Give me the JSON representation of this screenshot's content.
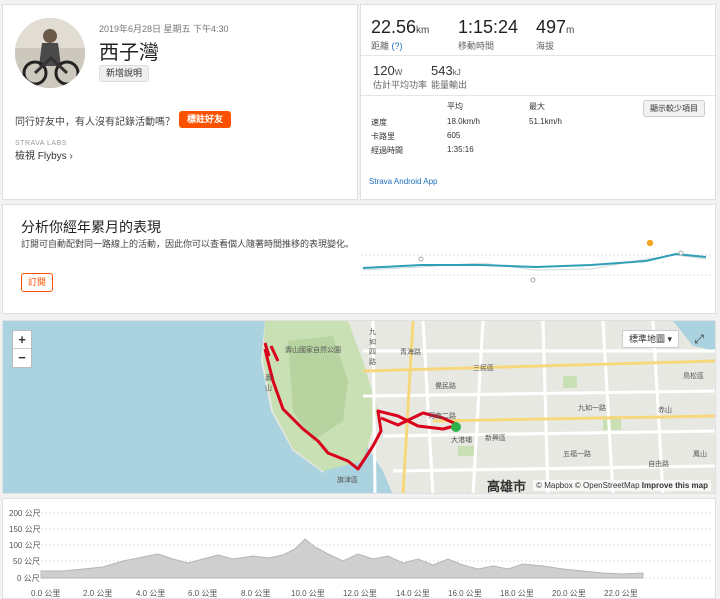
{
  "activity": {
    "date": "2019年6月28日 星期五 下午4:30",
    "title": "西子灣",
    "add_description": "新增說明",
    "friend_question": "同行好友中，有人沒有記錄活動嗎？",
    "tag_friends": "標註好友",
    "labs": "STRAVA LABS",
    "flybys": "檢視 Flybys",
    "flybys_icon": "chevron-right"
  },
  "stats": {
    "distance": {
      "value": "22.56",
      "unit": "km",
      "label": "距離",
      "help": "(?)"
    },
    "moving_time": {
      "value": "1:15:24",
      "label": "移動時間"
    },
    "elevation": {
      "value": "497",
      "unit": "m",
      "label": "海拔"
    },
    "power": {
      "value": "120",
      "unit": "W",
      "label": "估計平均功率"
    },
    "energy": {
      "value": "543",
      "unit": "kJ",
      "label": "能量輸出"
    },
    "table": {
      "headers": [
        "平均",
        "最大"
      ],
      "rows": [
        {
          "label": "速度",
          "avg": "18.0km/h",
          "max": "51.1km/h"
        },
        {
          "label": "卡路里",
          "avg": "605",
          "max": ""
        },
        {
          "label": "經過時間",
          "avg": "1:35:16",
          "max": ""
        }
      ]
    },
    "show_less": "顯示較少項目",
    "device": "Strava Android App"
  },
  "analysis": {
    "title": "分析你經年累月的表現",
    "text": "訂閱可自動配對同一路線上的活動，因此你可以查看個人隨著時間推移的表現變化。",
    "subscribe": "訂閱",
    "trend_color": "#2e9fb5",
    "highlight_color": "#f5a623"
  },
  "map": {
    "zoom_in": "+",
    "zoom_out": "−",
    "map_type": "標準地圖",
    "fullscreen_icon": "expand-icon",
    "attribution_mapbox": "© Mapbox",
    "attribution_osm": "© OpenStreetMap",
    "improve": "Improve this map",
    "city": "高雄市",
    "labels": [
      "壽山國家自然公園",
      "九如四路",
      "青海路",
      "三民區",
      "覺民路",
      "九如一路",
      "大港埔",
      "新興區",
      "五福一路",
      "自由路",
      "旗津區",
      "河南二路",
      "壽山",
      "鳥松區",
      "赤山",
      "鳳山"
    ],
    "route_color": "#d9001b",
    "end_marker_color": "#2db34a"
  },
  "elevation": {
    "y_ticks": [
      "200 公尺",
      "150 公尺",
      "100 公尺",
      "50 公尺",
      "0 公尺"
    ],
    "x_ticks": [
      "0.0 公里",
      "2.0 公里",
      "4.0 公里",
      "6.0 公里",
      "8.0 公里",
      "10.0 公里",
      "12.0 公里",
      "14.0 公里",
      "16.0 公里",
      "18.0 公里",
      "20.0 公里",
      "22.0 公里"
    ]
  }
}
